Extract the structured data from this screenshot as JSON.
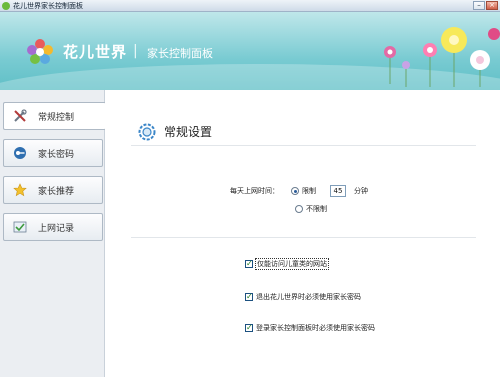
{
  "window": {
    "title": "花儿世界家长控制面板",
    "minimize_glyph": "–",
    "close_glyph": "×"
  },
  "header": {
    "brand": "花儿世界",
    "separator": "|",
    "subtitle": "家长控制面板"
  },
  "sidebar": {
    "items": [
      {
        "label": "常规控制",
        "icon": "wrench-screwdriver-icon",
        "active": true
      },
      {
        "label": "家长密码",
        "icon": "key-icon",
        "active": false
      },
      {
        "label": "家长推荐",
        "icon": "star-icon",
        "active": false
      },
      {
        "label": "上网记录",
        "icon": "record-icon",
        "active": false
      }
    ]
  },
  "main": {
    "section_title": "常规设置",
    "daily_time": {
      "label": "每天上网时间：",
      "limit_label": "限制",
      "limit_value": "45",
      "unit": "分钟",
      "unlimited_label": "不限制",
      "selected": "limit"
    },
    "options": [
      {
        "label": "仅能访问儿童类的网站",
        "checked": true
      },
      {
        "label": "退出花儿世界时必须使用家长密码",
        "checked": true
      },
      {
        "label": "登录家长控制面板时必须使用家长密码",
        "checked": true
      }
    ]
  },
  "colors": {
    "header_teal": "#79cbd2",
    "sidebar_bg": "#ebeef2",
    "accent_blue": "#2c5d9a"
  }
}
